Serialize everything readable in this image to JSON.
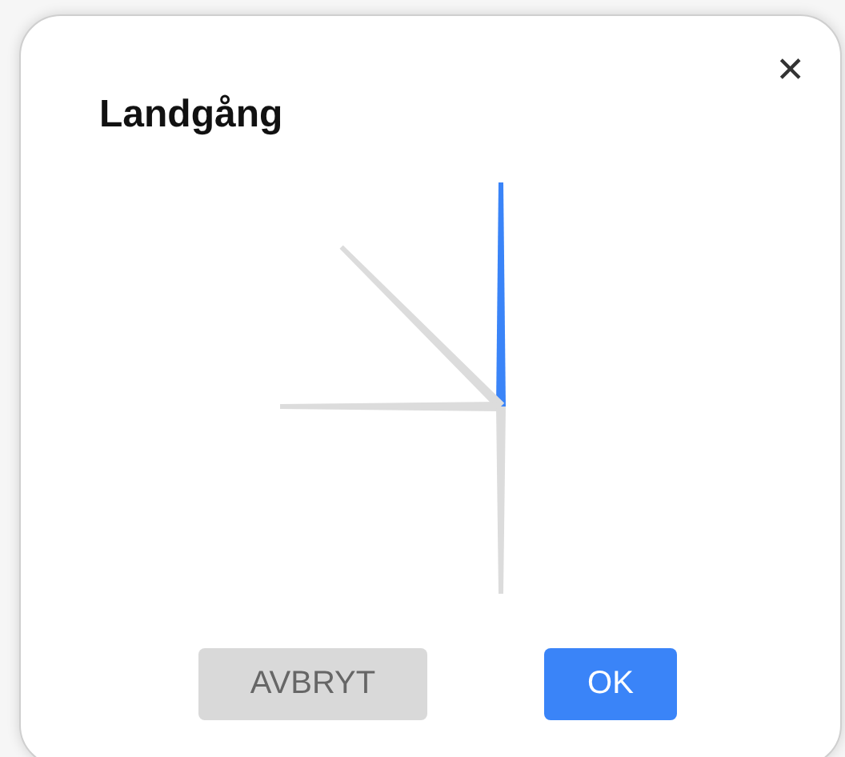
{
  "dialog": {
    "title": "Landgång",
    "close": "✕"
  },
  "needles": [
    {
      "kind": "up",
      "selected": true
    },
    {
      "kind": "up-left",
      "selected": false
    },
    {
      "kind": "left",
      "selected": false
    },
    {
      "kind": "down",
      "selected": false
    }
  ],
  "buttons": [
    {
      "label": "AVBRYT",
      "kind": "cancel"
    },
    {
      "label": "OK",
      "kind": "primary"
    }
  ]
}
